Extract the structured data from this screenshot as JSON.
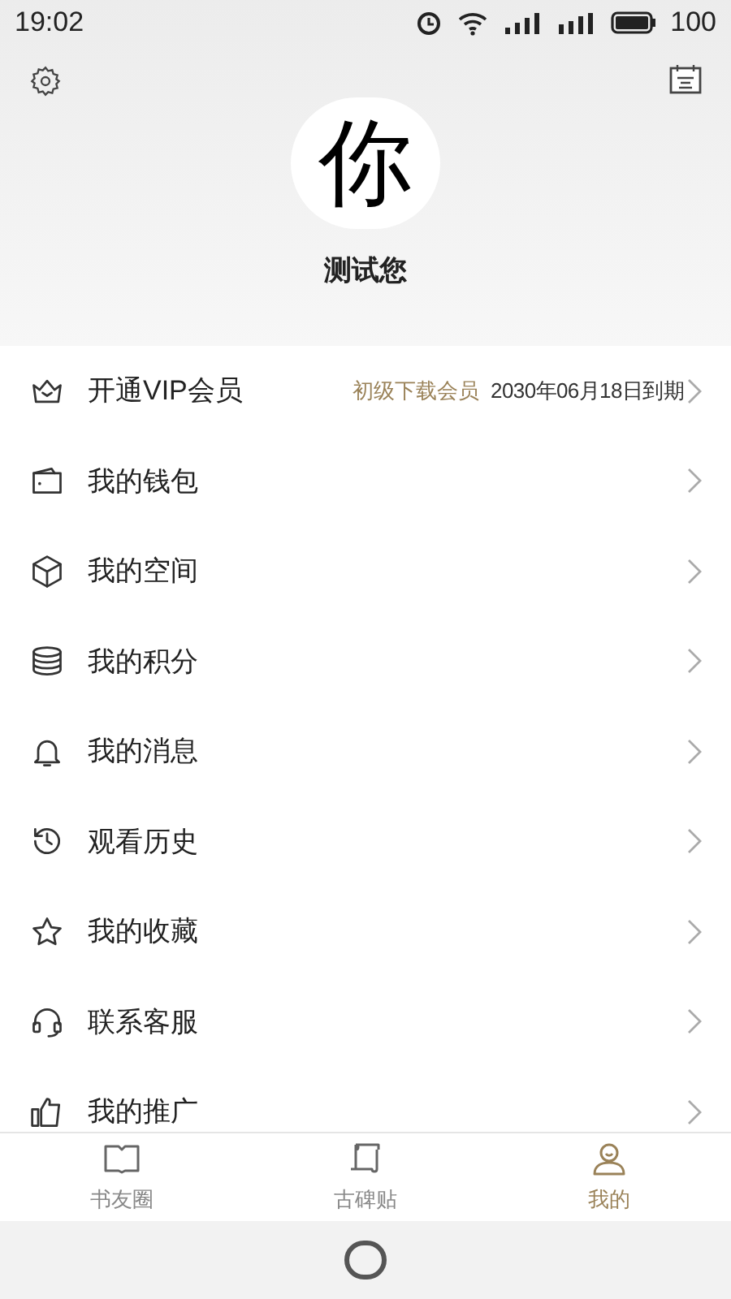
{
  "status_bar": {
    "time": "19:02",
    "battery": "100"
  },
  "profile": {
    "avatar": "你",
    "name": "测试您"
  },
  "menu": [
    {
      "label": "开通VIP会员",
      "badge": "初级下载会员",
      "detail": "2030年06月18日到期"
    },
    {
      "label": "我的钱包"
    },
    {
      "label": "我的空间"
    },
    {
      "label": "我的积分"
    },
    {
      "label": "我的消息"
    },
    {
      "label": "观看历史"
    },
    {
      "label": "我的收藏"
    },
    {
      "label": "联系客服"
    },
    {
      "label": "我的推广"
    }
  ],
  "tabs": [
    {
      "label": "书友圈",
      "selected": false
    },
    {
      "label": "古碑贴",
      "selected": false
    },
    {
      "label": "我的",
      "selected": true
    }
  ]
}
